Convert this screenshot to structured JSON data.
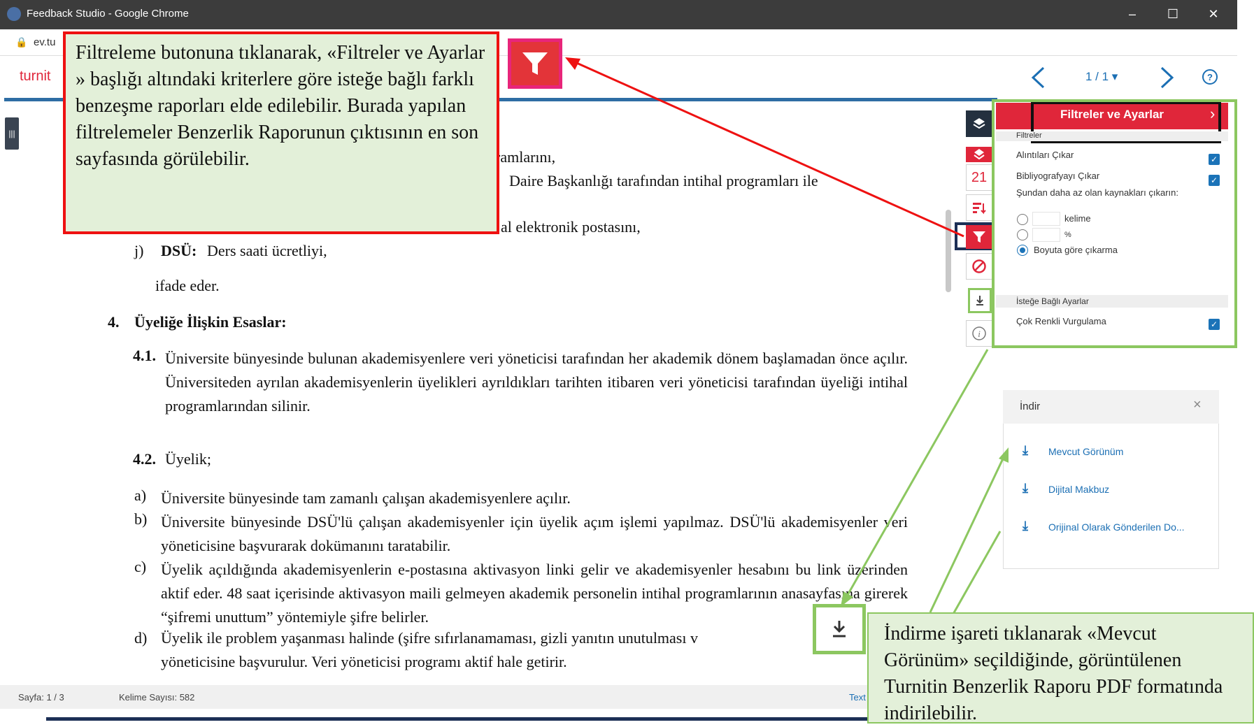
{
  "window": {
    "title": "Feedback Studio - Google Chrome",
    "url": "ev.tu"
  },
  "brand": {
    "logo_text": "turnit",
    "accent": "#e0263a",
    "link_blue": "#1b6fb4"
  },
  "pager": {
    "page_indicator": "1 / 1 ▾"
  },
  "document": {
    "frag1": "ogramlarını,",
    "frag2": "Daire Başkanlığı tarafından intihal programları ile",
    "frag3": "al elektronik postasını,",
    "j_letter": "j)",
    "j_bold": "DSÜ:",
    "j_rest": "Ders saati ücretliyi,",
    "ifade": "ifade eder.",
    "h4_num": "4.",
    "h4_title": "Üyeliğe İlişkin Esaslar:",
    "p41_num": "4.1.",
    "p41_text": "Üniversite bünyesinde bulunan akademisyenlere veri yöneticisi tarafından her akademik dönem başlamadan önce açılır. Üniversiteden ayrılan akademisyenlerin üyelikleri ayrıldıkları tarihten itibaren veri yöneticisi tarafından üyeliği intihal programlarından silinir.",
    "p42_num": "4.2.",
    "p42_text": "Üyelik;",
    "items": [
      {
        "letter": "a)",
        "text": "Üniversite bünyesinde tam zamanlı çalışan akademisyenlere açılır."
      },
      {
        "letter": "b)",
        "text": "Üniversite bünyesinde DSÜ'lü çalışan akademisyenler için üyelik açım işlemi yapılmaz. DSÜ'lü akademisyenler veri yöneticisine başvurarak dokümanını taratabilir."
      },
      {
        "letter": "c)",
        "text": "Üyelik açıldığında akademisyenlerin e-postasına aktivasyon linki gelir ve akademisyenler hesabını bu link üzerinden aktif eder. 48 saat içerisinde aktivasyon maili gelmeyen akademik personelin intihal programlarının anasayfasına girerek “şifremi unuttum” yöntemiyle şifre belirler."
      },
      {
        "letter": "d)",
        "text": "Üyelik ile problem yaşanması halinde (şifre sıfırlanamaması, gizli yanıtın unutulması v"
      },
      {
        "letter": "",
        "text": "yöneticisine başvurulur. Veri yöneticisi programı aktif hale getirir."
      }
    ]
  },
  "statusbar": {
    "page": "Sayfa: 1 / 3",
    "words": "Kelime Sayısı: 582",
    "right_link": "Text"
  },
  "toolstrip": {
    "match_count": "21"
  },
  "filters_panel": {
    "title": "Filtreler ve Ayarlar",
    "section_filters": "Filtreler",
    "exclude_quotes": "Alıntıları Çıkar",
    "exclude_bibliography": "Bibliyografyayı Çıkar",
    "exclude_small_sources": "Şundan daha az olan kaynakları çıkarın:",
    "words_option": "kelime",
    "percent_option": "%",
    "no_size_option": "Boyuta göre çıkarma",
    "section_optional": "İsteğe Bağlı Ayarlar",
    "multicolor": "Çok Renkli Vurgulama"
  },
  "download_panel": {
    "title": "İndir",
    "close": "×",
    "items": [
      "Mevcut Görünüm",
      "Dijital Makbuz",
      "Orijinal Olarak Gönderilen Do..."
    ]
  },
  "callout_filter": {
    "text": "Filtreleme butonuna tıklanarak, «Filtreler ve Ayarlar » başlığı altındaki kriterlere göre isteğe bağlı farklı benzeşme raporları elde edilebilir. Burada yapılan filtrelemeler Benzerlik Raporunun çıktısının en son sayfasında görülebilir."
  },
  "callout_download": {
    "text": "İndirme işareti tıklanarak «Mevcut Görünüm» seçildiğinde, görüntülenen Turnitin Benzerlik Raporu PDF formatında indirilebilir."
  }
}
